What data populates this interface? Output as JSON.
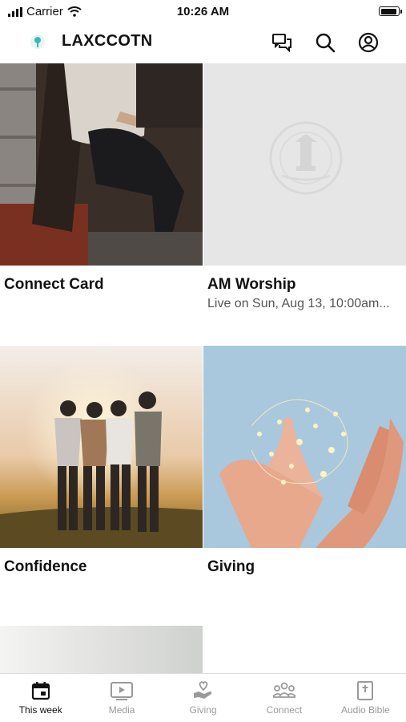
{
  "status": {
    "carrier": "Carrier",
    "time": "10:26 AM"
  },
  "header": {
    "app_name": "LAXCCOTN"
  },
  "tiles": [
    {
      "title": "Connect Card",
      "subtitle": ""
    },
    {
      "title": "AM Worship",
      "subtitle": "Live on Sun, Aug 13, 10:00am..."
    },
    {
      "title": "Confidence",
      "subtitle": ""
    },
    {
      "title": "Giving",
      "subtitle": ""
    }
  ],
  "tabs": [
    {
      "label": "This week",
      "icon": "calendar-icon",
      "active": true
    },
    {
      "label": "Media",
      "icon": "play-icon",
      "active": false
    },
    {
      "label": "Giving",
      "icon": "heart-hand-icon",
      "active": false
    },
    {
      "label": "Connect",
      "icon": "people-icon",
      "active": false
    },
    {
      "label": "Audio Bible",
      "icon": "bible-icon",
      "active": false
    }
  ],
  "colors": {
    "accent": "#111111",
    "inactive": "#9a9a9a",
    "logo": "#3fb8b0"
  }
}
